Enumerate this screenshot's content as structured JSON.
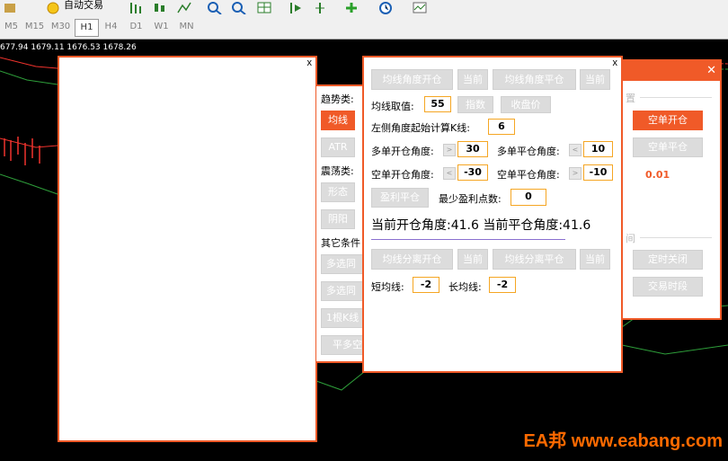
{
  "toolbar": {
    "auto_trade_label": "自动交易"
  },
  "timeframes": [
    "M5",
    "M15",
    "M30",
    "H1",
    "H4",
    "D1",
    "W1",
    "MN"
  ],
  "active_timeframe": "H1",
  "price_info": "677.94 1679.11 1676.53 1678.26",
  "left_panel": {
    "close": "x"
  },
  "side_panel": {
    "trend_label": "趋势类:",
    "ma_button": "均线",
    "atr_button": "ATR",
    "shock_label": "震荡类:",
    "pattern_button": "形态",
    "yinyang_button": "阴阳",
    "other_label": "其它条件",
    "multi1_button": "多选同",
    "multi2_button": "多选同",
    "kline_button": "1根K线",
    "flat_button": "平多空"
  },
  "main_panel": {
    "close": "x",
    "row1": [
      "均线角度开仓",
      "当前",
      "均线角度平仓",
      "当前"
    ],
    "ma_value_label": "均线取值:",
    "ma_value": "55",
    "index_button": "指数",
    "close_price_button": "收盘价",
    "left_angle_label": "左侧角度起始计算K线:",
    "left_angle_value": "6",
    "long_open_label": "多单开仓角度:",
    "long_open_value": "30",
    "long_close_label": "多单平仓角度:",
    "long_close_value": "10",
    "short_open_label": "空单开仓角度:",
    "short_open_value": "-30",
    "short_close_label": "空单平仓角度:",
    "short_close_value": "-10",
    "profit_close_button": "盈利平仓",
    "min_profit_label": "最少盈利点数:",
    "min_profit_value": "0",
    "current_angles": "当前开仓角度:41.6 当前平仓角度:41.6",
    "row2": [
      "均线分离开仓",
      "当前",
      "均线分离平仓",
      "当前"
    ],
    "short_ma_label": "短均线:",
    "short_ma_value": "-2",
    "long_ma_label": "长均线:",
    "long_ma_value": "-2",
    "arrow_right": ">",
    "arrow_left": "<"
  },
  "right_panel": {
    "close": "✕",
    "section1_title": "置",
    "short_open_button": "空单开仓",
    "short_close_button": "空单平仓",
    "lot_value": "0.01",
    "section2_title": "间",
    "timed_close_button": "定时关闭",
    "trade_time_button": "交易时段"
  },
  "watermark": "EA邦 www.eabang.com",
  "colors": {
    "accent": "#f05a28",
    "value_border": "#f5a623",
    "lot_value": "#f05a28"
  }
}
